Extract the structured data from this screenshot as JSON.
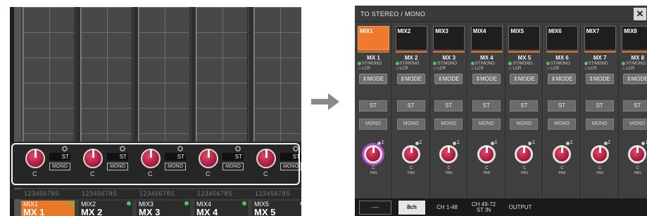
{
  "left_panel": {
    "channel_numbers": "12345678S",
    "knob_label": "C",
    "st_label": "ST",
    "mono_label": "MONO",
    "channels": [
      {
        "small": "MIX1",
        "big": "MX 1",
        "selected": true
      },
      {
        "small": "MIX2",
        "big": "MX 2",
        "selected": false
      },
      {
        "small": "MIX3",
        "big": "MX 3",
        "selected": false
      },
      {
        "small": "MIX4",
        "big": "MX 4",
        "selected": false
      },
      {
        "small": "MIX5",
        "big": "MX 5",
        "selected": false
      }
    ]
  },
  "window": {
    "title": "TO STEREO / MONO",
    "close_label": "✕",
    "st_mono_indicator": "ST/MONO",
    "lcr_indicator": "LCR",
    "mode_label": "⇕MODE",
    "st_button": "ST",
    "mono_button": "MONO",
    "knob_center": "C",
    "knob_pan": "PAN",
    "sigma": "Σ",
    "channels": [
      {
        "tag": "MIX1",
        "name": "MX 1",
        "selected": true
      },
      {
        "tag": "MIX2",
        "name": "MX 2",
        "selected": false
      },
      {
        "tag": "MIX3",
        "name": "MX 3",
        "selected": false
      },
      {
        "tag": "MIX4",
        "name": "MX 4",
        "selected": false
      },
      {
        "tag": "MIX5",
        "name": "MX 5",
        "selected": false
      },
      {
        "tag": "MIX6",
        "name": "MX 6",
        "selected": false
      },
      {
        "tag": "MIX7",
        "name": "MX 7",
        "selected": false
      },
      {
        "tag": "MIX8",
        "name": "MX 8",
        "selected": false
      }
    ],
    "tabs": [
      {
        "label": "----"
      },
      {
        "label": "8ch",
        "selected": true
      },
      {
        "label": "CH 1-48"
      },
      {
        "line1": "CH 49-72",
        "line2": "ST IN"
      },
      {
        "label": "OUTPUT"
      }
    ]
  },
  "colors": {
    "accent_orange": "#e8782a",
    "knob_red": "#a01838",
    "selected_ring": "#b84ad6",
    "status_green": "#46c85a",
    "indicator_cyan": "#5fd1e0"
  },
  "icons": {
    "arrow": "right-arrow-icon",
    "close": "close-icon"
  }
}
